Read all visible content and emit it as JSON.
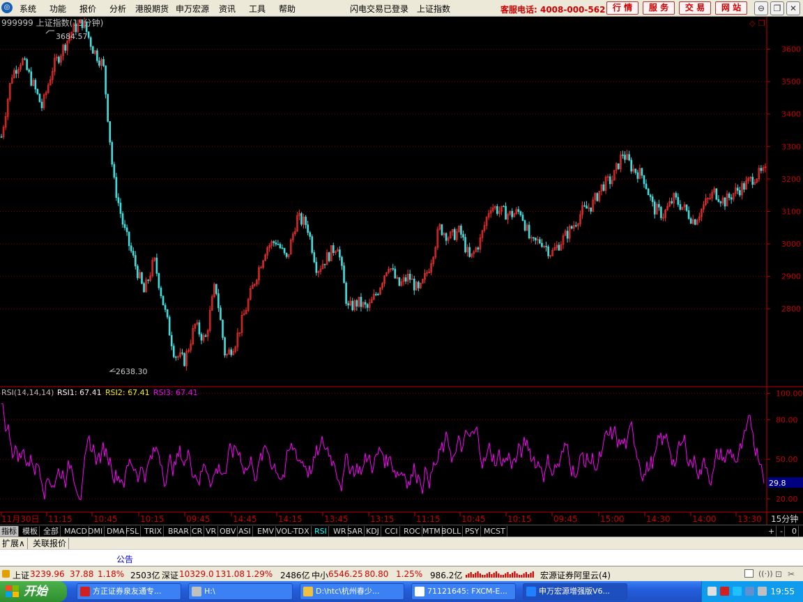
{
  "menubar": {
    "items": [
      "系统",
      "功能",
      "报价",
      "分析",
      "港股期货",
      "申万宏源",
      "资讯",
      "工具",
      "帮助"
    ],
    "center": [
      "闪电交易已登录",
      "上证指数"
    ],
    "hotline": "客服电话: 4008-000-562",
    "buttons": [
      "行 情",
      "服 务",
      "交 易",
      "网 站"
    ]
  },
  "chart": {
    "title": "999999 上证指数(15分钟)",
    "high_label": "3684.57",
    "low_label": "2638.30",
    "y_ticks": [
      "3600",
      "3500",
      "3400",
      "3300",
      "3200",
      "3100",
      "3000",
      "2900",
      "2800"
    ],
    "rsi_title": "RSI(14,14,14)",
    "rsi1": "RSI1: 67.41",
    "rsi2": "RSI2: 67.41",
    "rsi3": "RSI3: 67.41",
    "rsi_ticks": [
      "100.00",
      "80.00",
      "50.00",
      "20.00"
    ],
    "rsi_current": "29.8",
    "x_labels": [
      "11月30日",
      "11:15",
      "10:45",
      "10:15",
      "09:45",
      "14:45",
      "14:15",
      "13:45",
      "13:15",
      "11:15",
      "10:45",
      "10:15",
      "09:45",
      "15:00",
      "14:30",
      "14:00",
      "13:30"
    ],
    "period": "15分钟",
    "colors": {
      "up": "#ff3030",
      "down": "#40e0e0",
      "rsi": "#ff00ff",
      "axis": "#c00000"
    }
  },
  "chart_data": [
    {
      "type": "candlestick",
      "title": "999999 上证指数(15分钟)",
      "annotations": {
        "high": 3684.57,
        "low": 2638.3
      },
      "ylim": [
        2560,
        3700
      ],
      "x_tick_labels": [
        "11月30日",
        "11:15",
        "10:45",
        "10:15",
        "09:45",
        "14:45",
        "14:15",
        "13:45",
        "13:15",
        "11:15",
        "10:45",
        "10:15",
        "09:45",
        "15:00",
        "14:30",
        "14:00",
        "13:30"
      ],
      "close_path": [
        3330,
        3520,
        3570,
        3500,
        3420,
        3540,
        3600,
        3660,
        3684,
        3600,
        3550,
        3200,
        3050,
        2950,
        2850,
        2950,
        2800,
        2660,
        2640,
        2750,
        2700,
        2880,
        2650,
        2700,
        2800,
        2900,
        2990,
        3010,
        2950,
        3080,
        3060,
        2920,
        2960,
        3000,
        2800,
        2820,
        2800,
        2860,
        2940,
        2870,
        2900,
        2850,
        2930,
        3050,
        3020,
        3040,
        2950,
        3010,
        3120,
        3100,
        3090,
        3100,
        3000,
        3010,
        2970,
        3010,
        3050,
        3100,
        3120,
        3180,
        3200,
        3280,
        3230,
        3210,
        3110,
        3090,
        3140,
        3110,
        3070,
        3120,
        3160,
        3130,
        3160,
        3180,
        3210,
        3220
      ]
    },
    {
      "type": "line",
      "title": "RSI(14,14,14)",
      "ylim": [
        10,
        105
      ],
      "series": [
        {
          "name": "RSI1",
          "last": 67.41
        },
        {
          "name": "RSI2",
          "last": 67.41
        },
        {
          "name": "RSI3",
          "last": 67.41
        }
      ],
      "y_ticks": [
        100.0,
        80.0,
        50.0,
        20.0
      ],
      "current_marker": 29.8
    }
  ],
  "tabs": [
    "指标",
    "模板",
    "全部",
    "MACD",
    "DMI",
    "DMA",
    "FSL",
    "TRIX",
    "BRAR",
    "CR",
    "VR",
    "OBV",
    "ASI",
    "EMV",
    "VOL-TDX",
    "RSI",
    "WR",
    "SAR",
    "KDJ",
    "CCI",
    "ROC",
    "MTM",
    "BOLL",
    "PSY",
    "MCST"
  ],
  "tab_controls": [
    "+",
    "-",
    "0"
  ],
  "subtabs": [
    "扩展∧",
    "关联报价"
  ],
  "notice": "公告",
  "status": {
    "sh_label": "上证",
    "sh_value": "3239.96",
    "sh_change": "37.88",
    "sh_pct": "1.18%",
    "sh_amount": "2503亿",
    "sz_label": "深证",
    "sz_value": "10329.0",
    "sz_change": "131.08",
    "sz_pct": "1.29%",
    "sz_amount": "2486亿",
    "zx_label": "中小",
    "zx_value": "6546.25",
    "zx_change": "80.80",
    "zx_pct": "1.25%",
    "zx_amount": "986.2亿",
    "server": "宏源证券阿里云(4)"
  },
  "taskbar": {
    "start": "开始",
    "tasks": [
      "方正证券泉友通专...",
      "H:\\",
      "D:\\htc\\杭州春少...",
      "71121645: FXCM-E...",
      "申万宏源增强版V6..."
    ],
    "clock": "19:55"
  }
}
